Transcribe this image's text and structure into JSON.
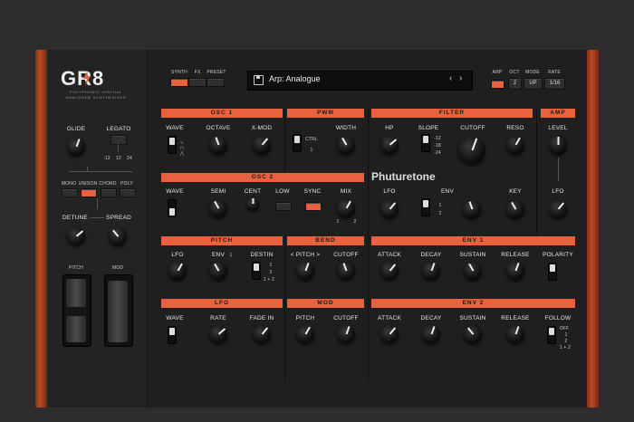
{
  "brand": {
    "logo": "GR8",
    "subtitle": "POLYPHONIC VIRTUAL ANALOGUE SYNTHESIZER",
    "maker": "Phuturetone"
  },
  "top": {
    "synth": "SYNTH",
    "fx": "FX",
    "preset_lbl": "PRESET",
    "preset_name": "Arp: Analogue",
    "arp": "ARP",
    "oct": "OCT",
    "mode": "MODE",
    "rate": "RATE",
    "oct_val": "2",
    "mode_val": "UP",
    "rate_val": "1/16"
  },
  "left": {
    "glide": "GLIDE",
    "legato": "LEGATO",
    "o1": "-12",
    "o2": "12",
    "o3": "24",
    "mono": "MONO",
    "unison": "UNISON",
    "chord": "CHORD",
    "poly": "POLY",
    "detune": "DETUNE",
    "spread": "SPREAD",
    "pitch": "PITCH",
    "mod": "MOD"
  },
  "osc1": {
    "title": "OSC 1",
    "wave": "WAVE",
    "octave": "OCTAVE",
    "xmod": "X-MOD"
  },
  "pwm": {
    "title": "PWM",
    "ctrl": "CTRL",
    "width": "WIDTH",
    "one": "1"
  },
  "filter": {
    "title": "FILTER",
    "hp": "HP",
    "slope": "SLOPE",
    "cutoff": "CUTOFF",
    "reso": "RESO",
    "s1": "-12",
    "s2": "-18",
    "s3": "-24",
    "lfo": "LFO",
    "env": "ENV",
    "key": "KEY",
    "e1": "1",
    "e2": "2"
  },
  "amp": {
    "title": "AMP",
    "level": "LEVEL",
    "lfo": "LFO"
  },
  "osc2": {
    "title": "OSC 2",
    "wave": "WAVE",
    "semi": "SEMI",
    "cent": "CENT",
    "low": "LOW",
    "sync": "SYNC",
    "mix": "MIX",
    "m1": "1",
    "m2": "2"
  },
  "pitch": {
    "title": "PITCH",
    "lfo": "LFO",
    "env": "ENV",
    "env1": "1",
    "destin": "DESTIN",
    "d1": "1",
    "d2": "2",
    "d3": "1 + 2"
  },
  "bend": {
    "title": "BEND",
    "pitch": "< PITCH >",
    "cutoff": "CUTOFF"
  },
  "env1": {
    "title": "ENV 1",
    "attack": "ATTACK",
    "decay": "DECAY",
    "sustain": "SUSTAIN",
    "release": "RELEASE",
    "polarity": "POLARITY"
  },
  "lfo": {
    "title": "LFO",
    "wave": "WAVE",
    "rate": "RATE",
    "fadein": "FADE IN"
  },
  "mod": {
    "title": "MOD",
    "pitch": "PITCH",
    "cutoff": "CUTOFF"
  },
  "env2": {
    "title": "ENV 2",
    "attack": "ATTACK",
    "decay": "DECAY",
    "sustain": "SUSTAIN",
    "release": "RELEASE",
    "follow": "FOLLOW",
    "f0": "OFF",
    "f1": "1",
    "f2": "2",
    "f3": "1 + 2"
  },
  "colors": {
    "accent": "#e8623e",
    "wood": "#b84a28",
    "panel": "#1f1f1f"
  }
}
